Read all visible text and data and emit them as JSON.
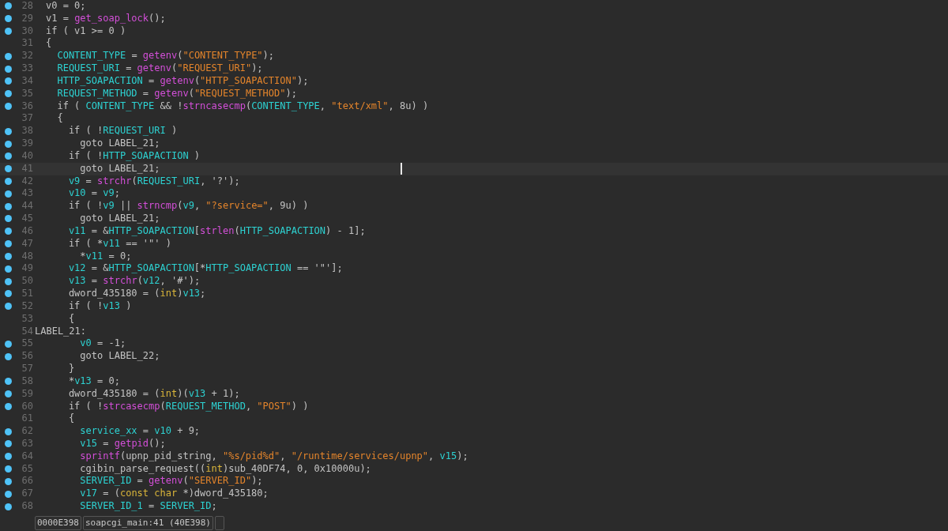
{
  "lines": [
    {
      "number": "28",
      "breakpoint": true,
      "current": false,
      "kind": "code",
      "tokens": [
        {
          "kind": "text",
          "text": "v0 = 0;"
        }
      ]
    },
    {
      "number": "29",
      "breakpoint": true,
      "current": false,
      "kind": "code",
      "tokens": [
        {
          "kind": "text",
          "text": "v1 = "
        },
        {
          "kind": "func",
          "text": "get_soap_lock"
        },
        {
          "kind": "text",
          "text": "();"
        }
      ]
    },
    {
      "number": "30",
      "breakpoint": true,
      "current": false,
      "kind": "code",
      "tokens": [
        {
          "kind": "text",
          "text": "if ( v1 >= 0 )"
        }
      ]
    },
    {
      "number": "31",
      "breakpoint": false,
      "current": false,
      "kind": "code",
      "tokens": [
        {
          "kind": "text",
          "text": "{"
        }
      ]
    },
    {
      "number": "32",
      "breakpoint": true,
      "current": false,
      "kind": "code",
      "tokens": [
        {
          "kind": "var",
          "text": "  CONTENT_TYPE"
        },
        {
          "kind": "text",
          "text": " = "
        },
        {
          "kind": "func",
          "text": "getenv"
        },
        {
          "kind": "text",
          "text": "("
        },
        {
          "kind": "string",
          "text": "\"CONTENT_TYPE\""
        },
        {
          "kind": "text",
          "text": ");"
        }
      ]
    },
    {
      "number": "33",
      "breakpoint": true,
      "current": false,
      "kind": "code",
      "tokens": [
        {
          "kind": "var",
          "text": "  REQUEST_URI"
        },
        {
          "kind": "text",
          "text": " = "
        },
        {
          "kind": "func",
          "text": "getenv"
        },
        {
          "kind": "text",
          "text": "("
        },
        {
          "kind": "string",
          "text": "\"REQUEST_URI\""
        },
        {
          "kind": "text",
          "text": ");"
        }
      ]
    },
    {
      "number": "34",
      "breakpoint": true,
      "current": false,
      "kind": "code",
      "tokens": [
        {
          "kind": "var",
          "text": "  HTTP_SOAPACTION"
        },
        {
          "kind": "text",
          "text": " = "
        },
        {
          "kind": "func",
          "text": "getenv"
        },
        {
          "kind": "text",
          "text": "("
        },
        {
          "kind": "string",
          "text": "\"HTTP_SOAPACTION\""
        },
        {
          "kind": "text",
          "text": ");"
        }
      ]
    },
    {
      "number": "35",
      "breakpoint": true,
      "current": false,
      "kind": "code",
      "tokens": [
        {
          "kind": "var",
          "text": "  REQUEST_METHOD"
        },
        {
          "kind": "text",
          "text": " = "
        },
        {
          "kind": "func",
          "text": "getenv"
        },
        {
          "kind": "text",
          "text": "("
        },
        {
          "kind": "string",
          "text": "\"REQUEST_METHOD\""
        },
        {
          "kind": "text",
          "text": ");"
        }
      ]
    },
    {
      "number": "36",
      "breakpoint": true,
      "current": false,
      "kind": "code",
      "tokens": [
        {
          "kind": "text",
          "text": "  if ( "
        },
        {
          "kind": "var",
          "text": "CONTENT_TYPE"
        },
        {
          "kind": "text",
          "text": " && !"
        },
        {
          "kind": "func",
          "text": "strncasecmp"
        },
        {
          "kind": "text",
          "text": "("
        },
        {
          "kind": "var",
          "text": "CONTENT_TYPE"
        },
        {
          "kind": "text",
          "text": ", "
        },
        {
          "kind": "string",
          "text": "\"text/xml\""
        },
        {
          "kind": "text",
          "text": ", 8u) )"
        }
      ]
    },
    {
      "number": "37",
      "breakpoint": false,
      "current": false,
      "kind": "code",
      "tokens": [
        {
          "kind": "text",
          "text": "  {"
        }
      ]
    },
    {
      "number": "38",
      "breakpoint": true,
      "current": false,
      "kind": "code",
      "tokens": [
        {
          "kind": "text",
          "text": "    if ( !"
        },
        {
          "kind": "var",
          "text": "REQUEST_URI"
        },
        {
          "kind": "text",
          "text": " )"
        }
      ]
    },
    {
      "number": "39",
      "breakpoint": true,
      "current": false,
      "kind": "code",
      "tokens": [
        {
          "kind": "text",
          "text": "      goto LABEL_21;"
        }
      ]
    },
    {
      "number": "40",
      "breakpoint": true,
      "current": false,
      "kind": "code",
      "tokens": [
        {
          "kind": "text",
          "text": "    if ( !"
        },
        {
          "kind": "var",
          "text": "HTTP_SOAPACTION"
        },
        {
          "kind": "text",
          "text": " )"
        }
      ]
    },
    {
      "number": "41",
      "breakpoint": true,
      "current": true,
      "kind": "code",
      "tokens": [
        {
          "kind": "text",
          "text": "      goto LABEL_21;"
        }
      ]
    },
    {
      "number": "42",
      "breakpoint": true,
      "current": false,
      "kind": "code",
      "tokens": [
        {
          "kind": "var",
          "text": "    v9"
        },
        {
          "kind": "text",
          "text": " = "
        },
        {
          "kind": "func",
          "text": "strchr"
        },
        {
          "kind": "text",
          "text": "("
        },
        {
          "kind": "var",
          "text": "REQUEST_URI"
        },
        {
          "kind": "text",
          "text": ", '?');"
        }
      ]
    },
    {
      "number": "43",
      "breakpoint": true,
      "current": false,
      "kind": "code",
      "tokens": [
        {
          "kind": "var",
          "text": "    v10"
        },
        {
          "kind": "text",
          "text": " = "
        },
        {
          "kind": "var",
          "text": "v9"
        },
        {
          "kind": "text",
          "text": ";"
        }
      ]
    },
    {
      "number": "44",
      "breakpoint": true,
      "current": false,
      "kind": "code",
      "tokens": [
        {
          "kind": "text",
          "text": "    if ( !"
        },
        {
          "kind": "var",
          "text": "v9"
        },
        {
          "kind": "text",
          "text": " || "
        },
        {
          "kind": "func",
          "text": "strncmp"
        },
        {
          "kind": "text",
          "text": "("
        },
        {
          "kind": "var",
          "text": "v9"
        },
        {
          "kind": "text",
          "text": ", "
        },
        {
          "kind": "string",
          "text": "\"?service=\""
        },
        {
          "kind": "text",
          "text": ", 9u) )"
        }
      ]
    },
    {
      "number": "45",
      "breakpoint": true,
      "current": false,
      "kind": "code",
      "tokens": [
        {
          "kind": "text",
          "text": "      goto LABEL_21;"
        }
      ]
    },
    {
      "number": "46",
      "breakpoint": true,
      "current": false,
      "kind": "code",
      "tokens": [
        {
          "kind": "var",
          "text": "    v11"
        },
        {
          "kind": "text",
          "text": " = &"
        },
        {
          "kind": "var",
          "text": "HTTP_SOAPACTION"
        },
        {
          "kind": "text",
          "text": "["
        },
        {
          "kind": "func",
          "text": "strlen"
        },
        {
          "kind": "text",
          "text": "("
        },
        {
          "kind": "var",
          "text": "HTTP_SOAPACTION"
        },
        {
          "kind": "text",
          "text": ") - 1];"
        }
      ]
    },
    {
      "number": "47",
      "breakpoint": true,
      "current": false,
      "kind": "code",
      "tokens": [
        {
          "kind": "text",
          "text": "    if ( *"
        },
        {
          "kind": "var",
          "text": "v11"
        },
        {
          "kind": "text",
          "text": " == '\"' )"
        }
      ]
    },
    {
      "number": "48",
      "breakpoint": true,
      "current": false,
      "kind": "code",
      "tokens": [
        {
          "kind": "text",
          "text": "      *"
        },
        {
          "kind": "var",
          "text": "v11"
        },
        {
          "kind": "text",
          "text": " = 0;"
        }
      ]
    },
    {
      "number": "49",
      "breakpoint": true,
      "current": false,
      "kind": "code",
      "tokens": [
        {
          "kind": "var",
          "text": "    v12"
        },
        {
          "kind": "text",
          "text": " = &"
        },
        {
          "kind": "var",
          "text": "HTTP_SOAPACTION"
        },
        {
          "kind": "text",
          "text": "[*"
        },
        {
          "kind": "var",
          "text": "HTTP_SOAPACTION"
        },
        {
          "kind": "text",
          "text": " == '\"'];"
        }
      ]
    },
    {
      "number": "50",
      "breakpoint": true,
      "current": false,
      "kind": "code",
      "tokens": [
        {
          "kind": "var",
          "text": "    v13"
        },
        {
          "kind": "text",
          "text": " = "
        },
        {
          "kind": "func",
          "text": "strchr"
        },
        {
          "kind": "text",
          "text": "("
        },
        {
          "kind": "var",
          "text": "v12"
        },
        {
          "kind": "text",
          "text": ", '#');"
        }
      ]
    },
    {
      "number": "51",
      "breakpoint": true,
      "current": false,
      "kind": "code",
      "tokens": [
        {
          "kind": "text",
          "text": "    dword_435180 = ("
        },
        {
          "kind": "type",
          "text": "int"
        },
        {
          "kind": "text",
          "text": ")"
        },
        {
          "kind": "var",
          "text": "v13"
        },
        {
          "kind": "text",
          "text": ";"
        }
      ]
    },
    {
      "number": "52",
      "breakpoint": true,
      "current": false,
      "kind": "code",
      "tokens": [
        {
          "kind": "text",
          "text": "    if ( !"
        },
        {
          "kind": "var",
          "text": "v13"
        },
        {
          "kind": "text",
          "text": " )"
        }
      ]
    },
    {
      "number": "53",
      "breakpoint": false,
      "current": false,
      "kind": "code",
      "tokens": [
        {
          "kind": "text",
          "text": "    {"
        }
      ]
    },
    {
      "number": "54",
      "breakpoint": false,
      "current": false,
      "kind": "label",
      "tokens": [
        {
          "kind": "text",
          "text": "LABEL_21:"
        }
      ]
    },
    {
      "number": "55",
      "breakpoint": true,
      "current": false,
      "kind": "code",
      "tokens": [
        {
          "kind": "var",
          "text": "      v0"
        },
        {
          "kind": "text",
          "text": " = -1;"
        }
      ]
    },
    {
      "number": "56",
      "breakpoint": true,
      "current": false,
      "kind": "code",
      "tokens": [
        {
          "kind": "text",
          "text": "      goto LABEL_22;"
        }
      ]
    },
    {
      "number": "57",
      "breakpoint": false,
      "current": false,
      "kind": "code",
      "tokens": [
        {
          "kind": "text",
          "text": "    }"
        }
      ]
    },
    {
      "number": "58",
      "breakpoint": true,
      "current": false,
      "kind": "code",
      "tokens": [
        {
          "kind": "text",
          "text": "    *"
        },
        {
          "kind": "var",
          "text": "v13"
        },
        {
          "kind": "text",
          "text": " = 0;"
        }
      ]
    },
    {
      "number": "59",
      "breakpoint": true,
      "current": false,
      "kind": "code",
      "tokens": [
        {
          "kind": "text",
          "text": "    dword_435180 = ("
        },
        {
          "kind": "type",
          "text": "int"
        },
        {
          "kind": "text",
          "text": ")("
        },
        {
          "kind": "var",
          "text": "v13"
        },
        {
          "kind": "text",
          "text": " + 1);"
        }
      ]
    },
    {
      "number": "60",
      "breakpoint": true,
      "current": false,
      "kind": "code",
      "tokens": [
        {
          "kind": "text",
          "text": "    if ( !"
        },
        {
          "kind": "func",
          "text": "strcasecmp"
        },
        {
          "kind": "text",
          "text": "("
        },
        {
          "kind": "var",
          "text": "REQUEST_METHOD"
        },
        {
          "kind": "text",
          "text": ", "
        },
        {
          "kind": "string",
          "text": "\"POST\""
        },
        {
          "kind": "text",
          "text": ") )"
        }
      ]
    },
    {
      "number": "61",
      "breakpoint": false,
      "current": false,
      "kind": "code",
      "tokens": [
        {
          "kind": "text",
          "text": "    {"
        }
      ]
    },
    {
      "number": "62",
      "breakpoint": true,
      "current": false,
      "kind": "code",
      "tokens": [
        {
          "kind": "var",
          "text": "      service_xx"
        },
        {
          "kind": "text",
          "text": " = "
        },
        {
          "kind": "var",
          "text": "v10"
        },
        {
          "kind": "text",
          "text": " + 9;"
        }
      ]
    },
    {
      "number": "63",
      "breakpoint": true,
      "current": false,
      "kind": "code",
      "tokens": [
        {
          "kind": "var",
          "text": "      v15"
        },
        {
          "kind": "text",
          "text": " = "
        },
        {
          "kind": "func",
          "text": "getpid"
        },
        {
          "kind": "text",
          "text": "();"
        }
      ]
    },
    {
      "number": "64",
      "breakpoint": true,
      "current": false,
      "kind": "code",
      "tokens": [
        {
          "kind": "func",
          "text": "      sprintf"
        },
        {
          "kind": "text",
          "text": "(upnp_pid_string, "
        },
        {
          "kind": "string",
          "text": "\"%s/pid%d\""
        },
        {
          "kind": "text",
          "text": ", "
        },
        {
          "kind": "string",
          "text": "\"/runtime/services/upnp\""
        },
        {
          "kind": "text",
          "text": ", "
        },
        {
          "kind": "var",
          "text": "v15"
        },
        {
          "kind": "text",
          "text": ");"
        }
      ]
    },
    {
      "number": "65",
      "breakpoint": true,
      "current": false,
      "kind": "code",
      "tokens": [
        {
          "kind": "text",
          "text": "      cgibin_parse_request(("
        },
        {
          "kind": "type",
          "text": "int"
        },
        {
          "kind": "text",
          "text": ")sub_40DF74, 0, 0x10000u);"
        }
      ]
    },
    {
      "number": "66",
      "breakpoint": true,
      "current": false,
      "kind": "code",
      "tokens": [
        {
          "kind": "var",
          "text": "      SERVER_ID"
        },
        {
          "kind": "text",
          "text": " = "
        },
        {
          "kind": "func",
          "text": "getenv"
        },
        {
          "kind": "text",
          "text": "("
        },
        {
          "kind": "string",
          "text": "\"SERVER_ID\""
        },
        {
          "kind": "text",
          "text": ");"
        }
      ]
    },
    {
      "number": "67",
      "breakpoint": true,
      "current": false,
      "kind": "code",
      "tokens": [
        {
          "kind": "var",
          "text": "      v17"
        },
        {
          "kind": "text",
          "text": " = ("
        },
        {
          "kind": "type",
          "text": "const char"
        },
        {
          "kind": "text",
          "text": " *)dword_435180;"
        }
      ]
    },
    {
      "number": "68",
      "breakpoint": true,
      "current": false,
      "kind": "code",
      "tokens": [
        {
          "kind": "var",
          "text": "      SERVER_ID_1"
        },
        {
          "kind": "text",
          "text": " = "
        },
        {
          "kind": "var",
          "text": "SERVER_ID"
        },
        {
          "kind": "text",
          "text": ";"
        }
      ]
    }
  ],
  "status_bar": {
    "address": "0000E398",
    "location": "soapcgi_main:41 (40E398)"
  }
}
